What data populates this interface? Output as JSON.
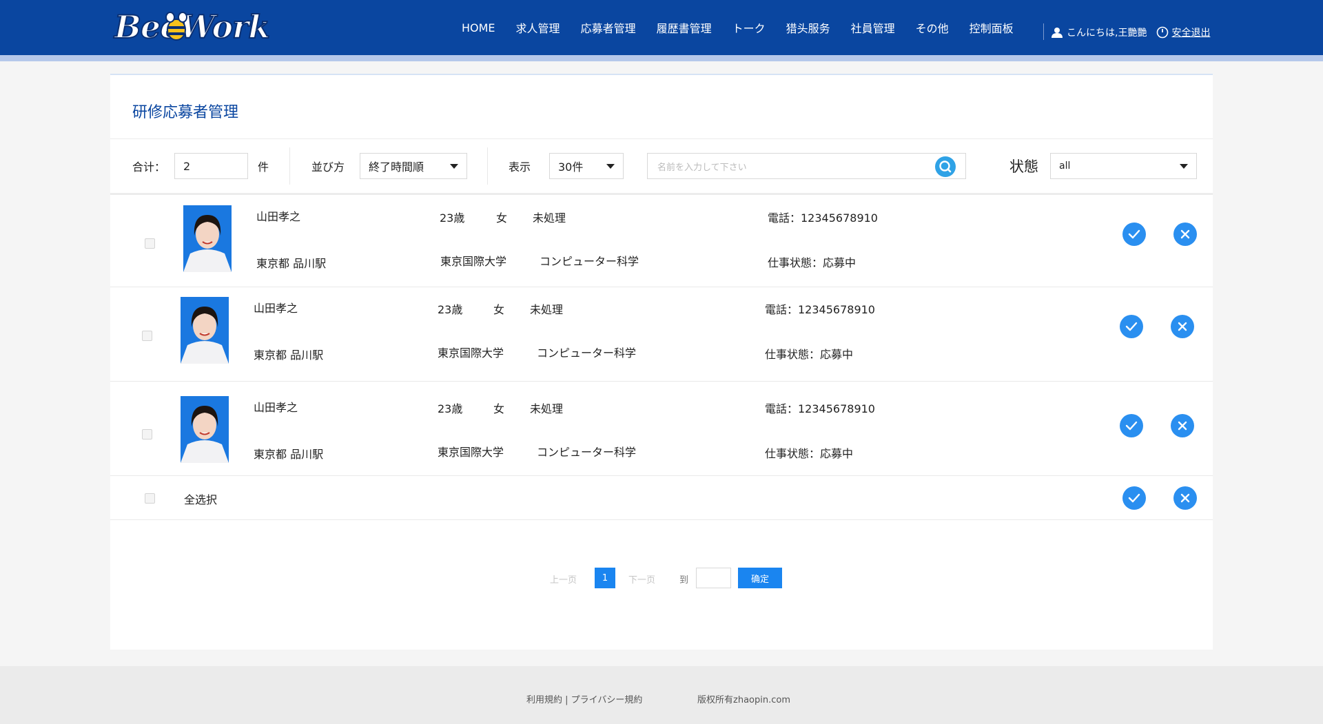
{
  "header": {
    "logo_text": "BeeWork",
    "nav": [
      "HOME",
      "求人管理",
      "応募者管理",
      "履歴書管理",
      "トーク",
      "猎头服务",
      "社員管理",
      "その他",
      "控制面板"
    ],
    "greeting": "こんにちは,王艷艷",
    "logout": "安全退出"
  },
  "page": {
    "title": "研修応募者管理"
  },
  "toolbar": {
    "total_label": "合计：",
    "total_value": "2",
    "total_unit": "件",
    "sort_label": "並び方",
    "sort_value": "終了時間順",
    "display_label": "表示",
    "display_value": "30件",
    "search_placeholder": "名前を入力して下さい",
    "status_label": "状態",
    "status_value": "all"
  },
  "applicants": [
    {
      "name": "山田孝之",
      "location": "東京都 品川駅",
      "age": "23歳",
      "gender": "女",
      "process": "未処理",
      "university": "東京国際大学",
      "major": "コンピューター科学",
      "phone": "電話：12345678910",
      "work_status": "仕事状態：応募中"
    },
    {
      "name": "山田孝之",
      "location": "東京都 品川駅",
      "age": "23歳",
      "gender": "女",
      "process": "未処理",
      "university": "東京国際大学",
      "major": "コンピューター科学",
      "phone": "電話：12345678910",
      "work_status": "仕事状態：応募中"
    },
    {
      "name": "山田孝之",
      "location": "東京都 品川駅",
      "age": "23歳",
      "gender": "女",
      "process": "未処理",
      "university": "東京国際大学",
      "major": "コンピューター科学",
      "phone": "電話：12345678910",
      "work_status": "仕事状態：応募中"
    }
  ],
  "select_all": "全选択",
  "pagination": {
    "prev": "上一页",
    "current": "1",
    "next": "下一页",
    "goto": "到",
    "confirm": "确定"
  },
  "footer": {
    "links": "利用規約 | プライバシー規約",
    "copyright": "版权所有zhaopin.com"
  },
  "colors": {
    "header_bg": "#0a46a0",
    "accent": "#2a8ff0",
    "title": "#0a46a0"
  }
}
